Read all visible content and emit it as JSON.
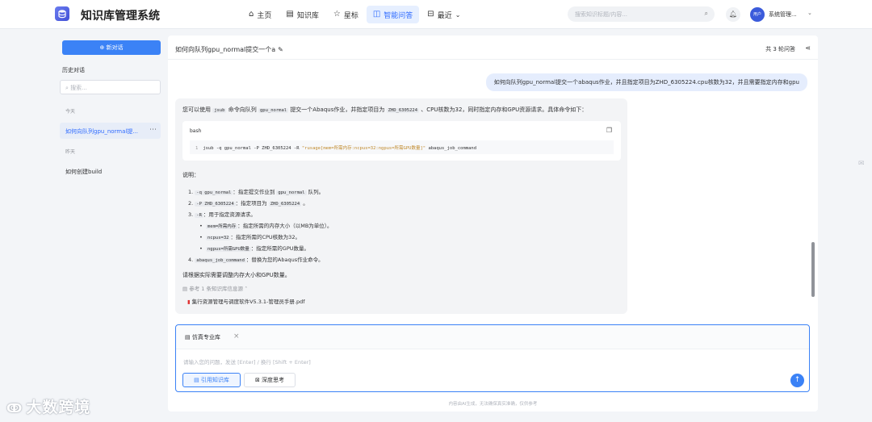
{
  "app": {
    "title": "知识库管理系统"
  },
  "nav": [
    {
      "icon": "⌂",
      "label": "主页",
      "active": false
    },
    {
      "icon": "▤",
      "label": "知识库",
      "active": false
    },
    {
      "icon": "☆",
      "label": "星标",
      "active": false
    },
    {
      "icon": "◫",
      "label": "智能问答",
      "active": true
    },
    {
      "icon": "⊟",
      "label": "最近",
      "active": false
    }
  ],
  "header": {
    "search_placeholder": "搜索知识标题/内容...",
    "avatar_text": "用户",
    "user_name": "系统管理..."
  },
  "sidebar": {
    "new_chat": "新对话",
    "history_title": "历史对话",
    "search_placeholder": "搜索...",
    "groups": [
      {
        "label": "今天",
        "items": [
          {
            "title": "如何向队列gpu_normal提...",
            "active": true
          }
        ]
      },
      {
        "label": "昨天",
        "items": [
          {
            "title": "如何创建build",
            "active": false
          }
        ]
      }
    ]
  },
  "chat": {
    "title": "如何向队列gpu_normal提交一个a",
    "rounds": "共 3 轮问答",
    "user_message": "如何向队列gpu_normal提交一个abaqus作业，并且指定项目为ZHD_6305224.cpu核数为32，并且需要指定内存和gpu",
    "ai": {
      "intro": {
        "t1": "您可以使用",
        "c1": "jsub",
        "t2": "命令向队列",
        "c2": "gpu_normal",
        "t3": "提交一个Abaqus作业，并指定项目为",
        "c3": "ZHD_6305224",
        "t4": "、CPU核数为32，同时指定内存和GPU资源请求。具体命令如下："
      },
      "code": {
        "lang": "bash",
        "line_no": "1",
        "cmd": "jsub -q gpu_normal -P ZHD_6305224 -R",
        "str": "\"rusage[mem=所需内存:ncpus=32:ngpus=所需GPU数量]\"",
        "tail": "abaqus_job_command"
      },
      "note_title": "说明：",
      "items": [
        {
          "n": "1.",
          "code": "-q gpu_normal",
          "t1": "：指定提交作业到",
          "code2": "gpu_normal",
          "t2": "队列。"
        },
        {
          "n": "2.",
          "code": "-P ZHD_6305224",
          "t1": "：指定项目为",
          "code2": "ZHD_6305224",
          "t2": "。"
        },
        {
          "n": "3.",
          "code": "-R",
          "t1": "：用于指定资源请求。",
          "code2": "",
          "t2": ""
        },
        {
          "n": "4.",
          "code": "abaqus_job_command",
          "t1": "：替换为您的Abaqus作业命令。",
          "code2": "",
          "t2": ""
        }
      ],
      "subitems": [
        {
          "code": "mem=所需内存",
          "t": "：指定所需的内存大小（以MB为单位）。"
        },
        {
          "code": "ncpus=32",
          "t": "：指定所需的CPU核数为32。"
        },
        {
          "code": "ngpus=所需GPU数量",
          "t": "：指定所需的GPU数量。"
        }
      ],
      "closing": "请根据实际需要调整内存大小和GPU数量。",
      "reference": "参考 1 条知识库信息源",
      "pdf": "集行资源管理与调度软件V5.3.1-管理员手册.pdf"
    }
  },
  "composer": {
    "kb_tag": "仿真专业库",
    "placeholder": "请输入您的问题，发送 [Enter] / 换行 [Shift + Enter]",
    "btn_kb": "引用知识库",
    "btn_deep": "深度思考"
  },
  "footer": {
    "disclaimer": "内容由AI生成，无法确保真实准确，仅供参考"
  },
  "watermark": "大数跨境"
}
